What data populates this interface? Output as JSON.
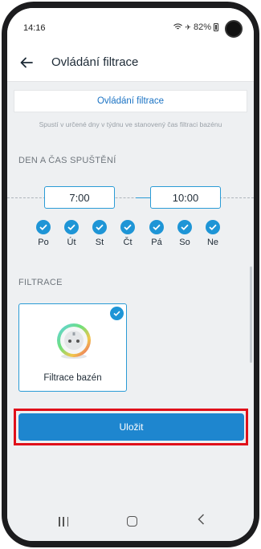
{
  "status_bar": {
    "time": "14:16",
    "battery": "82%"
  },
  "header": {
    "title": "Ovládání filtrace"
  },
  "section": {
    "title": "Ovládání filtrace",
    "description": "Spustí v určené dny v týdnu ve stanovený čas filtraci bazénu"
  },
  "schedule": {
    "label": "DEN A ČAS SPUŠTĚNÍ",
    "start_time": "7:00",
    "end_time": "10:00",
    "days": [
      {
        "label": "Po",
        "checked": true
      },
      {
        "label": "Út",
        "checked": true
      },
      {
        "label": "St",
        "checked": true
      },
      {
        "label": "Čt",
        "checked": true
      },
      {
        "label": "Pá",
        "checked": true
      },
      {
        "label": "So",
        "checked": true
      },
      {
        "label": "Ne",
        "checked": true
      }
    ]
  },
  "filtration": {
    "label": "FILTRACE",
    "device_name": "Filtrace bazén",
    "selected": true
  },
  "actions": {
    "save_label": "Uložit"
  },
  "colors": {
    "accent": "#1e86cf",
    "highlight": "#e0101a"
  }
}
